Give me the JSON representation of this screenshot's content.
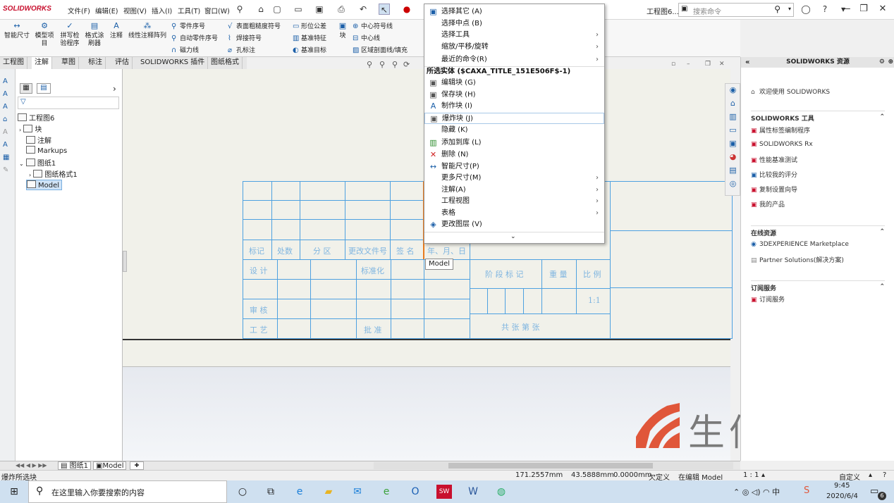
{
  "titlebar": {
    "logo": "SOLIDWORKS",
    "menus": [
      "文件(F)",
      "编辑(E)",
      "视图(V)",
      "插入(I)",
      "工具(T)",
      "窗口(W)"
    ],
    "doc_title": "工程图6...",
    "search_placeholder": "搜索命令"
  },
  "cmdmgr": {
    "big": [
      "智能尺寸",
      "模型项目",
      "拼写检验程序",
      "格式涂刷器",
      "注释",
      "线性注释阵列"
    ],
    "small_col1": [
      "零件序号",
      "自动零件序号",
      "磁力线"
    ],
    "small_col2": [
      "表面粗糙度符号",
      "焊接符号",
      "孔标注"
    ],
    "small_col3": [
      "形位公差",
      "基准特征",
      "基准目标"
    ],
    "block": "块",
    "small_col4": [
      "中心符号线",
      "中心线",
      "区域剖面线/填充"
    ]
  },
  "tabs": [
    "工程图",
    "注解",
    "草图",
    "标注",
    "评估",
    "SOLIDWORKS 插件",
    "图纸格式"
  ],
  "tree": {
    "root": "工程图6",
    "items": [
      "块",
      "注解",
      "Markups",
      "图纸1",
      "图纸格式1",
      "Model"
    ]
  },
  "context_menu": {
    "items": [
      "选择其它 (A)",
      "选择中点 (B)",
      "选择工具",
      "缩放/平移/旋转",
      "最近的命令(R)"
    ],
    "header": "所选实体 ($CAXA_TITLE_151E506F$-1)",
    "entity_items": [
      "编辑块 (G)",
      "保存块 (H)",
      "制作块 (I)",
      "爆炸块 (J)",
      "隐藏 (K)",
      "添加到库 (L)",
      "删除 (N)",
      "智能尺寸(P)",
      "更多尺寸(M)",
      "注解(A)",
      "工程视图",
      "表格",
      "更改图层 (V)"
    ],
    "tooltip": "Model"
  },
  "title_block": {
    "labels": [
      "标记",
      "处数",
      "分 区",
      "更改文件号",
      "签 名",
      "年、月、日",
      "设 计",
      "标准化",
      "阶 段 标 记",
      "重 量",
      "比 例",
      "审 核",
      "工 艺",
      "批 准",
      "共    张  第    张"
    ],
    "scale_value": "1:1"
  },
  "right_panel": {
    "title": "SOLIDWORKS 资源",
    "welcome": "欢迎使用 SOLIDWORKS",
    "tools_header": "SOLIDWORKS 工具",
    "tools": [
      "属性标签编制程序",
      "SOLIDWORKS Rx",
      "性能基准测试",
      "比较我的评分",
      "复制设置向导",
      "我的产品"
    ],
    "online_header": "在线资源",
    "online": [
      "3DEXPERIENCE Marketplace",
      "Partner Solutions(解决方案)"
    ],
    "sub_header": "订阅服务",
    "sub": [
      "订阅服务"
    ]
  },
  "sheet_tabs": [
    "图纸1",
    "Model"
  ],
  "status": {
    "left": "爆炸所选块",
    "x": "171.2557mm",
    "y": "43.5888mm",
    "z": "0.0000mm",
    "defined": "欠定义",
    "editing": "在编辑 Model",
    "scale": "1 : 1",
    "custom": "自定义"
  },
  "taskbar": {
    "search_placeholder": "在这里输入你要搜索的内容",
    "time": "9:45",
    "date": "2020/6/4",
    "notif_count": "6"
  },
  "watermark": "生信科技",
  "colors": {
    "accent": "#1b5fa8",
    "table_line": "#4ea1e0",
    "table_text": "#7fb5e0",
    "highlight": "#e87b1e",
    "brand_red": "#c8102e"
  }
}
